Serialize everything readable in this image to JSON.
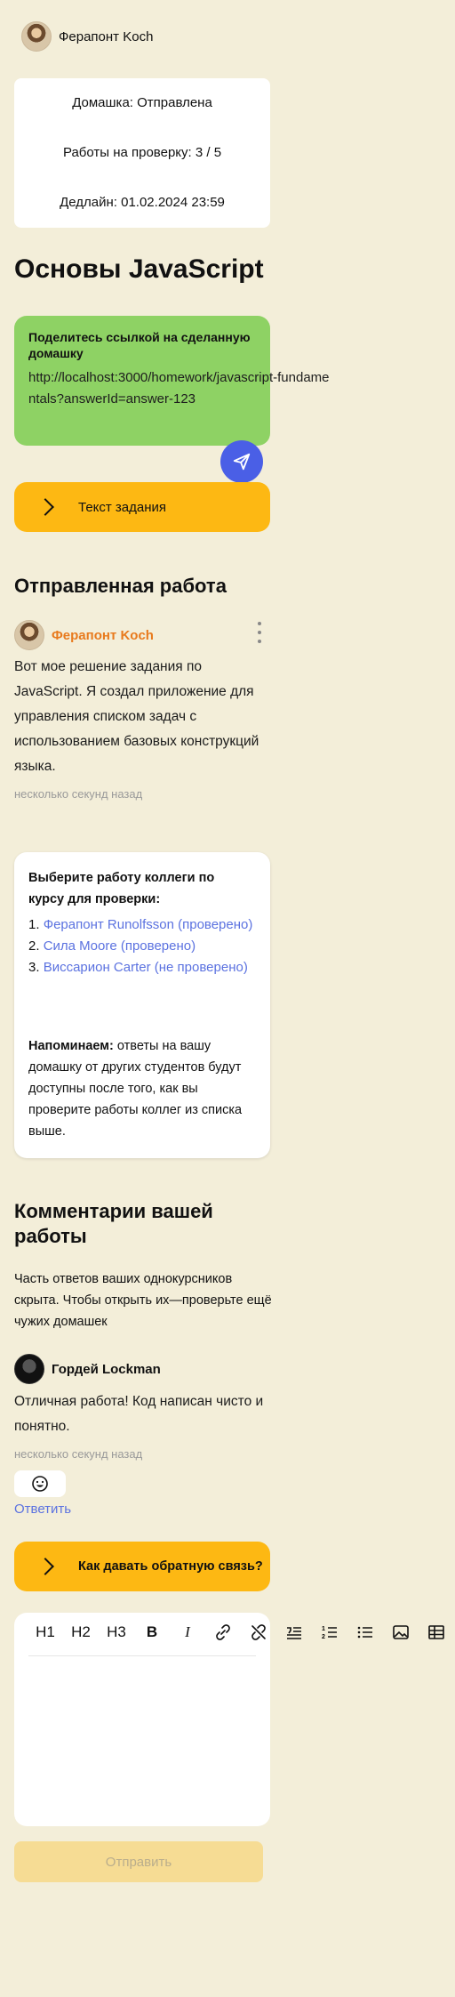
{
  "header": {
    "user_name": "Ферапонт Koch"
  },
  "status": {
    "homework": "Домашка: Отправлена",
    "reviews_label": "Работы на проверку: ",
    "reviews_value": "3 / 5",
    "deadline": "Дедлайн: 01.02.2024 23:59"
  },
  "page_title": "Основы JavaScript",
  "share": {
    "title": "Поделитесь ссылкой на сделанную домашку",
    "link": "http://localhost:3000/homework/javascript-fundamentals?answerId=answer-123"
  },
  "task_button": "Текст задания",
  "submitted": {
    "heading": "Отправленная работа",
    "author": "Ферапонт Koch",
    "text": "Вот мое решение задания по JavaScript. Я создал приложение для управления списком задач с использованием базовых конструкций языка.",
    "time": "несколько секунд назад"
  },
  "review": {
    "title": "Выберите работу коллеги по курсу для проверки:",
    "items": [
      {
        "num": "1.",
        "label": "Ферапонт Runolfsson (проверено)"
      },
      {
        "num": "2.",
        "label": "Сила Moore (проверено)"
      },
      {
        "num": "3.",
        "label": "Виссарион Carter (не проверено)"
      }
    ],
    "reminder_bold": "Напоминаем:",
    "reminder_text": " ответы на вашу домашку от других студентов будут доступны после того, как вы проверите работы коллег из списка выше."
  },
  "comments": {
    "heading": "Комментарии вашей работы",
    "note": "Часть ответов ваших однокурсников скрыта. Чтобы открыть их—проверьте ещё чужих домашек",
    "author": "Гордей Lockman",
    "text": "Отличная работа! Код написан чисто и понятно.",
    "time": "несколько секунд назад",
    "reply": "Ответить"
  },
  "feedback_button": "Как давать обратную связь?",
  "editor": {
    "tools": [
      "H1",
      "H2",
      "H3",
      "B",
      "I",
      "link",
      "unlink",
      "quote",
      "ordered-list",
      "bullet-list",
      "image",
      "table"
    ],
    "submit": "Отправить"
  },
  "colors": {
    "background": "#f3eed9",
    "green": "#8ed264",
    "yellow": "#fdb813",
    "blue": "#4a5fe6",
    "orange": "#e87a1d",
    "link": "#5b72e0"
  }
}
